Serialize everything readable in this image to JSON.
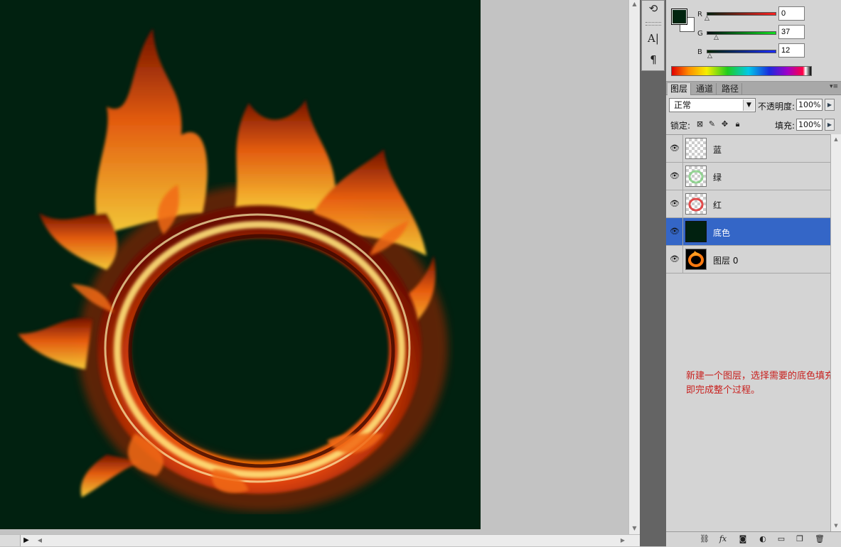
{
  "document": {
    "background_color": "#012110"
  },
  "color_panel": {
    "foreground": "#012510",
    "background": "#ffffff",
    "channels": [
      {
        "label": "R",
        "value": "0",
        "track_color": "#e02020",
        "level": 0.0
      },
      {
        "label": "G",
        "value": "37",
        "track_color": "#18c018",
        "level": 0.145
      },
      {
        "label": "B",
        "value": "12",
        "track_color": "#1a2bdd",
        "level": 0.047
      }
    ]
  },
  "layers_panel": {
    "tabs": [
      {
        "label": "图层",
        "active": true
      },
      {
        "label": "通道",
        "active": false
      },
      {
        "label": "路径",
        "active": false
      }
    ],
    "blend_mode": "正常",
    "opacity_label": "不透明度:",
    "opacity_value": "100%",
    "lock_label": "锁定:",
    "fill_label": "填充:",
    "fill_value": "100%",
    "layers": [
      {
        "name": "蓝",
        "visible": true,
        "selected": false,
        "thumb": "transparent"
      },
      {
        "name": "绿",
        "visible": true,
        "selected": false,
        "thumb": "green-flame"
      },
      {
        "name": "红",
        "visible": true,
        "selected": false,
        "thumb": "red-flame"
      },
      {
        "name": "底色",
        "visible": true,
        "selected": true,
        "thumb": "solid-dark-green"
      },
      {
        "name": "图层 0",
        "visible": true,
        "selected": false,
        "thumb": "fire-ring"
      }
    ]
  },
  "annotation": {
    "text": "新建一个图层，选择需要的底色填充即完成整个过程。"
  },
  "icons": {
    "dock": [
      "history-icon",
      "character-icon",
      "paragraph-icon"
    ],
    "panel_bottom": [
      "link-icon",
      "fx-icon",
      "mask-icon",
      "adjustment-icon",
      "group-icon",
      "new-layer-icon",
      "trash-icon"
    ]
  }
}
